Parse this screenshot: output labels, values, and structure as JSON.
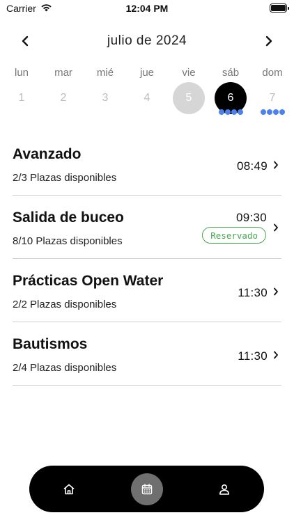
{
  "status_bar": {
    "carrier": "Carrier",
    "time": "12:04 PM",
    "icons": [
      "wifi-icon",
      "battery-icon"
    ]
  },
  "calendar": {
    "month_label": "julio de 2024",
    "prev_icon": "chevron-left-icon",
    "next_icon": "chevron-right-icon",
    "days": [
      {
        "name": "lun",
        "number": "1",
        "state": "normal",
        "events": 0
      },
      {
        "name": "mar",
        "number": "2",
        "state": "normal",
        "events": 0
      },
      {
        "name": "mié",
        "number": "3",
        "state": "normal",
        "events": 0
      },
      {
        "name": "jue",
        "number": "4",
        "state": "normal",
        "events": 0
      },
      {
        "name": "vie",
        "number": "5",
        "state": "today",
        "events": 0
      },
      {
        "name": "sáb",
        "number": "6",
        "state": "selected",
        "events": 4
      },
      {
        "name": "dom",
        "number": "7",
        "state": "normal",
        "events": 4
      }
    ]
  },
  "sessions": [
    {
      "title": "Avanzado",
      "availability": "2/3 Plazas disponibles",
      "time": "08:49",
      "badge": ""
    },
    {
      "title": "Salida de buceo",
      "availability": "8/10 Plazas disponibles",
      "time": "09:30",
      "badge": "Reservado"
    },
    {
      "title": "Prácticas Open Water",
      "availability": "2/2 Plazas disponibles",
      "time": "11:30",
      "badge": ""
    },
    {
      "title": "Bautismos",
      "availability": "2/4 Plazas disponibles",
      "time": "11:30",
      "badge": ""
    }
  ],
  "tabbar": {
    "tabs": [
      {
        "icon": "home-icon",
        "active": false
      },
      {
        "icon": "calendar-icon",
        "active": true
      },
      {
        "icon": "user-icon",
        "active": false
      }
    ]
  },
  "colors": {
    "event_dot": "#4c82f0",
    "reserved_badge": "#46a84f",
    "selected_day": "#000000",
    "today_day": "#d6d6d6",
    "tabbar_bg": "#000000",
    "active_tab": "#6f6f6f"
  }
}
